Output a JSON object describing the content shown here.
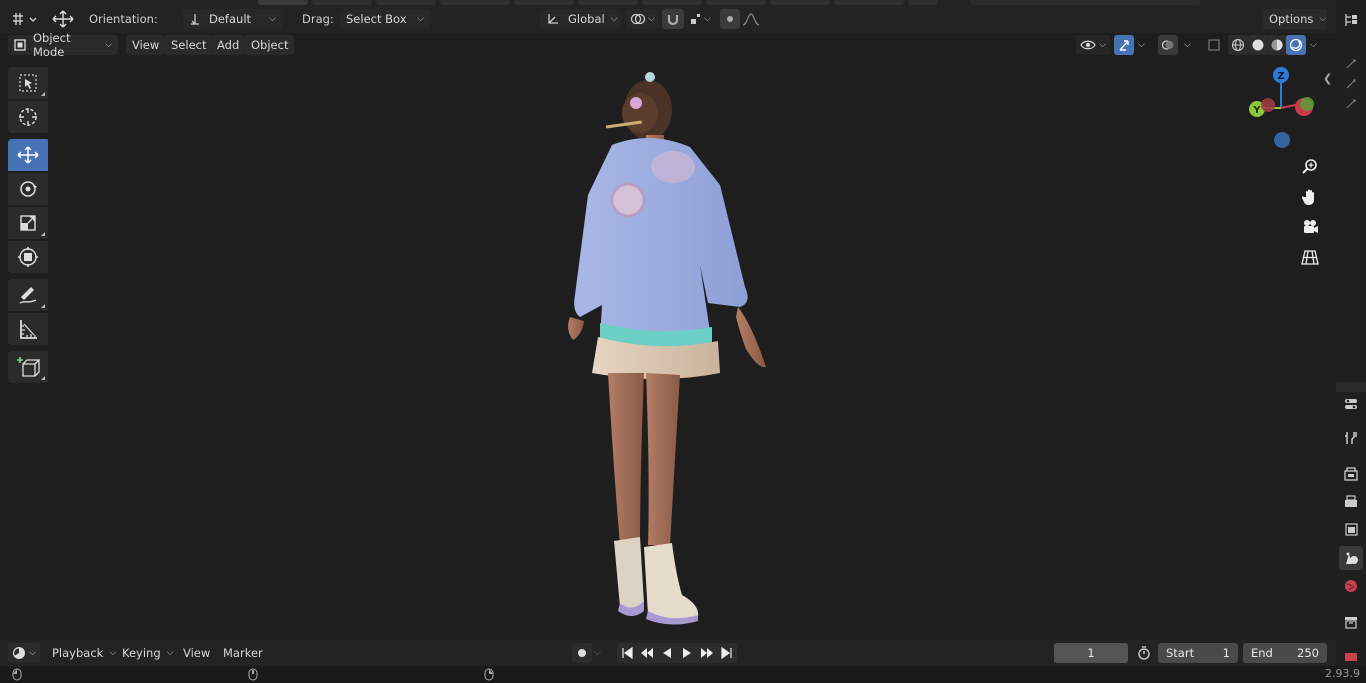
{
  "header": {
    "orientation_label": "Orientation:",
    "orientation_value": "Default",
    "drag_label": "Drag:",
    "drag_value": "Select Box",
    "transform_orientation": "Global",
    "options_label": "Options"
  },
  "viewport_header": {
    "mode": "Object Mode",
    "menus": [
      "View",
      "Select",
      "Add",
      "Object"
    ]
  },
  "gizmo": {
    "z": "Z",
    "y": "Y"
  },
  "timeline": {
    "menus": [
      "Playback",
      "Keying",
      "View",
      "Marker"
    ],
    "current_frame": "1",
    "start_label": "Start",
    "start_value": "1",
    "end_label": "End",
    "end_value": "250"
  },
  "status": {
    "version": "2.93.9"
  },
  "colors": {
    "accent": "#4772b3",
    "axis_x": "#c93a4a",
    "axis_y": "#8bc83c",
    "axis_z": "#2e7bd2",
    "axis_neg_z": "#35659e"
  }
}
